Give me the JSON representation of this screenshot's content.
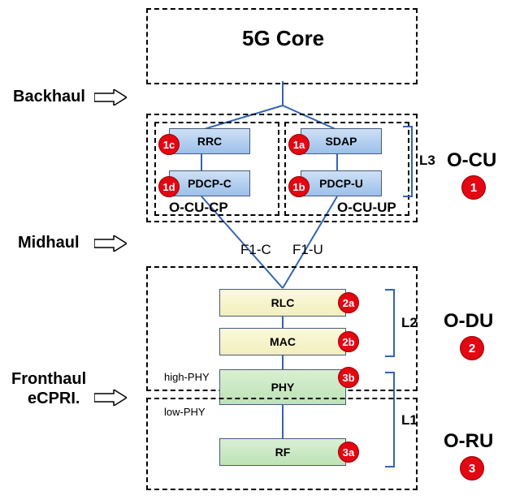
{
  "title": "5G Core",
  "hauls": {
    "back": "Backhaul",
    "mid": "Midhaul",
    "front1": "Fronthaul",
    "front2": "eCPRI."
  },
  "cu": {
    "right_label": "O-CU",
    "badge": "1",
    "cp_label": "O-CU-CP",
    "up_label": "O-CU-UP",
    "rrc": "RRC",
    "pdcpc": "PDCP-C",
    "sdap": "SDAP",
    "pdcpu": "PDCP-U",
    "badges": {
      "rrc": "1c",
      "pdcpc": "1d",
      "sdap": "1a",
      "pdcpu": "1b"
    },
    "layer": "L3"
  },
  "interfaces": {
    "f1c": "F1-C",
    "f1u": "F1-U"
  },
  "du": {
    "right_label": "O-DU",
    "badge": "2",
    "rlc": "RLC",
    "mac": "MAC",
    "badges": {
      "rlc": "2a",
      "mac": "2b"
    },
    "layer": "L2"
  },
  "phy": {
    "label": "PHY",
    "high": "high-PHY",
    "low": "low-PHY",
    "badge_high": "3b",
    "layer": "L1"
  },
  "ru": {
    "right_label": "O-RU",
    "badge": "3",
    "rf": "RF",
    "badge_rf": "3a"
  }
}
